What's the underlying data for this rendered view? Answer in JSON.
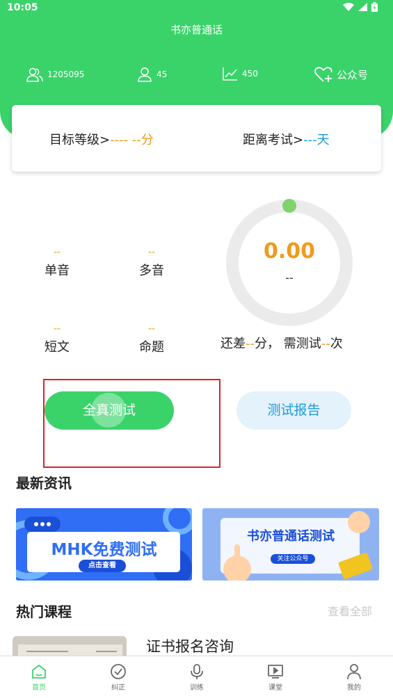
{
  "status_bar": {
    "time": "10:05"
  },
  "header": {
    "title": "书亦普通话"
  },
  "stats": {
    "users": {
      "icon": "users-icon",
      "value": "1205095"
    },
    "person": {
      "icon": "person-icon",
      "value": "45"
    },
    "trend": {
      "icon": "trend-chart-icon",
      "value": "450"
    },
    "follow": {
      "icon": "heart-plus-icon",
      "label": "公众号"
    }
  },
  "target": {
    "level_label": "目标等级>",
    "level_value": "---- --",
    "level_unit": "分",
    "exam_label": "距离考试>",
    "exam_value": "---",
    "exam_unit": "天"
  },
  "scores": [
    {
      "value": "--",
      "label": "单音"
    },
    {
      "value": "--",
      "label": "多音"
    },
    {
      "value": "--",
      "label": "短文"
    },
    {
      "value": "--",
      "label": "命题"
    }
  ],
  "ring": {
    "value": "0.00",
    "sub": "--",
    "progress": 0
  },
  "remaining": {
    "prefix": "还差",
    "points": "--",
    "mid": "分，  需测试",
    "times": "--",
    "suffix": "次"
  },
  "buttons": {
    "full_test": "全真测试",
    "report": "测试报告"
  },
  "news": {
    "title": "最新资讯",
    "items": [
      {
        "title": "MHK免费测试",
        "tag": "点击查看"
      },
      {
        "title": "书亦普通话测试",
        "tag": "关注公众号"
      }
    ]
  },
  "courses": {
    "title": "热门课程",
    "more": "查看全部",
    "items": [
      {
        "title": "证书报名咨询"
      }
    ]
  },
  "tabbar": [
    {
      "label": "首页",
      "icon": "home-icon",
      "active": true
    },
    {
      "label": "纠正",
      "icon": "check-circle-icon",
      "active": false
    },
    {
      "label": "训练",
      "icon": "microphone-icon",
      "active": false
    },
    {
      "label": "课堂",
      "icon": "video-play-icon",
      "active": false
    },
    {
      "label": "我的",
      "icon": "profile-icon",
      "active": false
    }
  ],
  "colors": {
    "primary": "#3ad36a",
    "accent": "#f09a1e",
    "info": "#1a9ad9"
  }
}
